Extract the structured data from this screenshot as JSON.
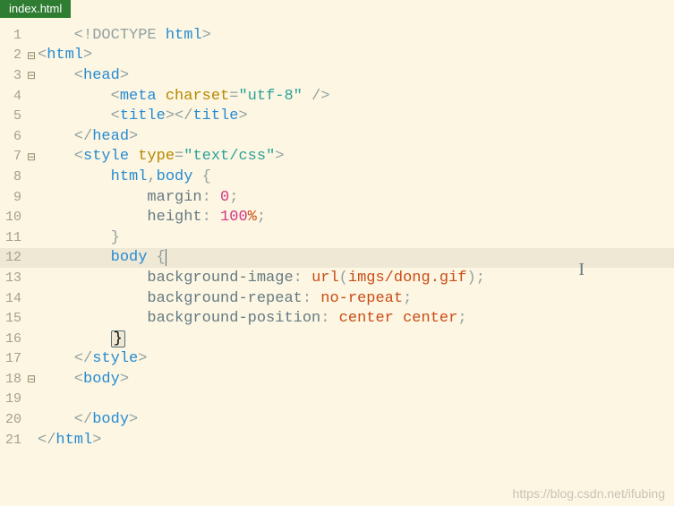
{
  "tab": {
    "label": "index.html"
  },
  "watermark": "https://blog.csdn.net/ifubing",
  "highlighted_line": 12,
  "fold_lines": [
    2,
    3,
    7,
    18
  ],
  "lines": [
    {
      "n": 1,
      "tokens": [
        [
          "p",
          "    <!"
        ],
        [
          "doctype",
          "DOCTYPE"
        ],
        [
          "p",
          " "
        ],
        [
          "tg",
          "html"
        ],
        [
          "p",
          ">"
        ]
      ]
    },
    {
      "n": 2,
      "tokens": [
        [
          "p",
          "<"
        ],
        [
          "tg",
          "html"
        ],
        [
          "p",
          ">"
        ]
      ]
    },
    {
      "n": 3,
      "tokens": [
        [
          "p",
          "    <"
        ],
        [
          "tg",
          "head"
        ],
        [
          "p",
          ">"
        ]
      ]
    },
    {
      "n": 4,
      "tokens": [
        [
          "p",
          "        <"
        ],
        [
          "tg",
          "meta"
        ],
        [
          "p",
          " "
        ],
        [
          "at",
          "charset"
        ],
        [
          "p",
          "="
        ],
        [
          "st",
          "\"utf-8\""
        ],
        [
          "p",
          " />"
        ]
      ]
    },
    {
      "n": 5,
      "tokens": [
        [
          "p",
          "        <"
        ],
        [
          "tg",
          "title"
        ],
        [
          "p",
          "></"
        ],
        [
          "tg",
          "title"
        ],
        [
          "p",
          ">"
        ]
      ]
    },
    {
      "n": 6,
      "tokens": [
        [
          "p",
          "    </"
        ],
        [
          "tg",
          "head"
        ],
        [
          "p",
          ">"
        ]
      ]
    },
    {
      "n": 7,
      "tokens": [
        [
          "p",
          "    <"
        ],
        [
          "tg",
          "style"
        ],
        [
          "p",
          " "
        ],
        [
          "at",
          "type"
        ],
        [
          "p",
          "="
        ],
        [
          "st",
          "\"text/css\""
        ],
        [
          "p",
          ">"
        ]
      ]
    },
    {
      "n": 8,
      "tokens": [
        [
          "p",
          "        "
        ],
        [
          "sel",
          "html"
        ],
        [
          "p",
          ","
        ],
        [
          "sel",
          "body"
        ],
        [
          "p",
          " {"
        ]
      ]
    },
    {
      "n": 9,
      "tokens": [
        [
          "p",
          "            "
        ],
        [
          "prop",
          "margin"
        ],
        [
          "p",
          ": "
        ],
        [
          "num",
          "0"
        ],
        [
          "p",
          ";"
        ]
      ]
    },
    {
      "n": 10,
      "tokens": [
        [
          "p",
          "            "
        ],
        [
          "prop",
          "height"
        ],
        [
          "p",
          ": "
        ],
        [
          "num",
          "100"
        ],
        [
          "val",
          "%"
        ],
        [
          "p",
          ";"
        ]
      ]
    },
    {
      "n": 11,
      "tokens": [
        [
          "p",
          "        }"
        ]
      ]
    },
    {
      "n": 12,
      "tokens": [
        [
          "p",
          "        "
        ],
        [
          "sel",
          "body"
        ],
        [
          "p",
          " {"
        ]
      ],
      "cursor_after": true
    },
    {
      "n": 13,
      "tokens": [
        [
          "p",
          "            "
        ],
        [
          "prop",
          "background-image"
        ],
        [
          "p",
          ": "
        ],
        [
          "val",
          "url"
        ],
        [
          "p",
          "("
        ],
        [
          "val",
          "imgs/dong.gif"
        ],
        [
          "p",
          ");"
        ]
      ]
    },
    {
      "n": 14,
      "tokens": [
        [
          "p",
          "            "
        ],
        [
          "prop",
          "background-repeat"
        ],
        [
          "p",
          ": "
        ],
        [
          "val",
          "no-repeat"
        ],
        [
          "p",
          ";"
        ]
      ]
    },
    {
      "n": 15,
      "tokens": [
        [
          "p",
          "            "
        ],
        [
          "prop",
          "background-position"
        ],
        [
          "p",
          ": "
        ],
        [
          "val",
          "center"
        ],
        [
          "p",
          " "
        ],
        [
          "val",
          "center"
        ],
        [
          "p",
          ";"
        ]
      ]
    },
    {
      "n": 16,
      "tokens": [
        [
          "p",
          "        "
        ],
        [
          "box",
          "}"
        ]
      ]
    },
    {
      "n": 17,
      "tokens": [
        [
          "p",
          "    </"
        ],
        [
          "tg",
          "style"
        ],
        [
          "p",
          ">"
        ]
      ]
    },
    {
      "n": 18,
      "tokens": [
        [
          "p",
          "    <"
        ],
        [
          "tg",
          "body"
        ],
        [
          "p",
          ">"
        ]
      ]
    },
    {
      "n": 19,
      "tokens": [
        [
          "p",
          ""
        ]
      ]
    },
    {
      "n": 20,
      "tokens": [
        [
          "p",
          "    </"
        ],
        [
          "tg",
          "body"
        ],
        [
          "p",
          ">"
        ]
      ]
    },
    {
      "n": 21,
      "tokens": [
        [
          "p",
          "</"
        ],
        [
          "tg",
          "html"
        ],
        [
          "p",
          ">"
        ]
      ]
    }
  ]
}
